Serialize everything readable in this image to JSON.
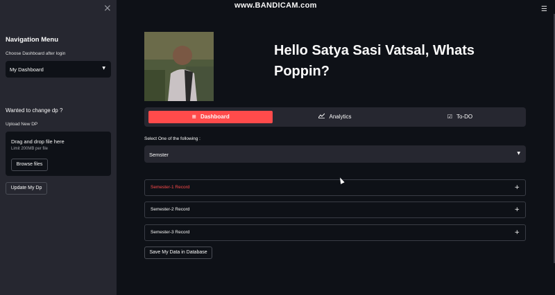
{
  "sidebar": {
    "close_glyph": "×",
    "title": "Navigation Menu",
    "dashboard_prompt": "Choose Dashboard after login",
    "dashboard_select_value": "My Dashboard",
    "change_dp_question": "Wanted to change dp ?",
    "upload_label": "Upload New DP",
    "dropzone_title": "Drag and drop file here",
    "dropzone_limit": "Limit 200MB per file",
    "browse_button": "Browse files",
    "update_button": "Update My Dp"
  },
  "watermark": "www.BANDICAM.com",
  "greeting": "Hello Satya Sasi Vatsal, Whats Poppin?",
  "nav": {
    "items": [
      {
        "label": "Dashboard",
        "icon": "menu-icon",
        "active": true
      },
      {
        "label": "Analytics",
        "icon": "chart-line-icon",
        "active": false
      },
      {
        "label": "To-DO",
        "icon": "checkbox-icon",
        "active": false
      }
    ]
  },
  "main": {
    "select_label": "Select One of the following :",
    "select_value": "Semster",
    "expanders": [
      {
        "label": "Semester-1 Record",
        "highlighted": true
      },
      {
        "label": "Semester-2 Record",
        "highlighted": false
      },
      {
        "label": "Semester-3 Record",
        "highlighted": false
      }
    ],
    "save_button": "Save My Data in Database"
  },
  "colors": {
    "accent": "#ff4b4b",
    "background": "#0e1117",
    "sidebar": "#262730"
  }
}
